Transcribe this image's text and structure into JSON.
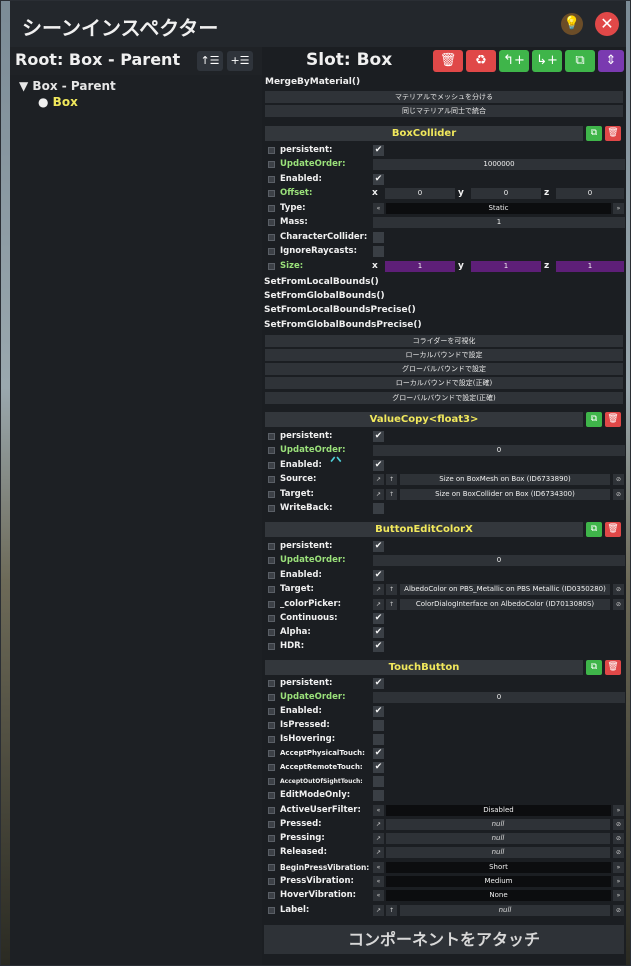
{
  "window": {
    "title": "シーンインスペクター",
    "help_icon": "help-icon",
    "close_icon": "close-icon"
  },
  "left": {
    "root_label": "Root: Box - Parent",
    "tree": {
      "root": "Box - Parent",
      "child": "Box"
    }
  },
  "slot": {
    "label": "Slot: Box"
  },
  "slot_actions": {
    "merge": "MergeByMaterial()",
    "bar1": "マテリアルでメッシュを分ける",
    "bar2": "同じマテリアル同士で統合"
  },
  "box_collider": {
    "title": "BoxCollider",
    "fields": {
      "persistent": "persistent:",
      "update_order": "UpdateOrder:",
      "update_order_value": "1000000",
      "enabled": "Enabled:",
      "offset": "Offset:",
      "offset_x": "0",
      "offset_y": "0",
      "offset_z": "0",
      "type": "Type:",
      "type_value": "Static",
      "mass": "Mass:",
      "mass_value": "1",
      "character_collider": "CharacterCollider:",
      "ignore_raycasts": "IgnoreRaycasts:",
      "size": "Size:",
      "size_x": "1",
      "size_y": "1",
      "size_z": "1"
    },
    "methods": [
      "SetFromLocalBounds()",
      "SetFromGlobalBounds()",
      "SetFromLocalBoundsPrecise()",
      "SetFromGlobalBoundsPrecise()"
    ],
    "bars": [
      "コライダーを可視化",
      "ローカルバウンドで設定",
      "グローバルバウンドで設定",
      "ローカルバウンドで設定(正確)",
      "グローバルバウンドで設定(正確)"
    ]
  },
  "value_copy": {
    "title": "ValueCopy<float3>",
    "fields": {
      "persistent": "persistent:",
      "update_order": "UpdateOrder:",
      "update_order_value": "0",
      "enabled": "Enabled:",
      "source": "Source:",
      "source_value": "Size on BoxMesh on Box (ID6733890)",
      "target": "Target:",
      "target_value": "Size on BoxCollider on Box (ID6734300)",
      "write_back": "WriteBack:"
    }
  },
  "button_edit_color": {
    "title": "ButtonEditColorX",
    "fields": {
      "persistent": "persistent:",
      "update_order": "UpdateOrder:",
      "update_order_value": "0",
      "enabled": "Enabled:",
      "target": "Target:",
      "target_value": "AlbedoColor on PBS_Metallic on PBS Metallic (ID0350280)",
      "color_picker": "_colorPicker:",
      "color_picker_value": "ColorDialogInterface on AlbedoColor (ID7013080S)",
      "continuous": "Continuous:",
      "alpha": "Alpha:",
      "hdr": "HDR:"
    }
  },
  "touch_button": {
    "title": "TouchButton",
    "fields": {
      "persistent": "persistent:",
      "update_order": "UpdateOrder:",
      "update_order_value": "0",
      "enabled": "Enabled:",
      "is_pressed": "IsPressed:",
      "is_hovering": "IsHovering:",
      "accept_physical": "AcceptPhysicalTouch:",
      "accept_remote": "AcceptRemoteTouch:",
      "accept_out_of_sight": "AcceptOutOfSightTouch:",
      "edit_mode_only": "EditModeOnly:",
      "active_user_filter": "ActiveUserFilter:",
      "active_user_filter_value": "Disabled",
      "pressed": "Pressed:",
      "pressing": "Pressing:",
      "released": "Released:",
      "null": "null",
      "begin_press_vibration": "BeginPressVibration:",
      "begin_press_vibration_value": "Short",
      "press_vibration": "PressVibration:",
      "press_vibration_value": "Medium",
      "hover_vibration": "HoverVibration:",
      "hover_vibration_value": "None",
      "label": "Label:"
    }
  },
  "attach_button": "コンポーネントをアタッチ",
  "glyphs": {
    "check": "✔",
    "left": "«",
    "right": "»",
    "copy": "⧉",
    "trash": "🗑",
    "ref": "↗",
    "up": "↑",
    "clear": "⊘",
    "tri": "▼",
    "dot": "●",
    "x": "x",
    "y": "y",
    "z": "z"
  }
}
